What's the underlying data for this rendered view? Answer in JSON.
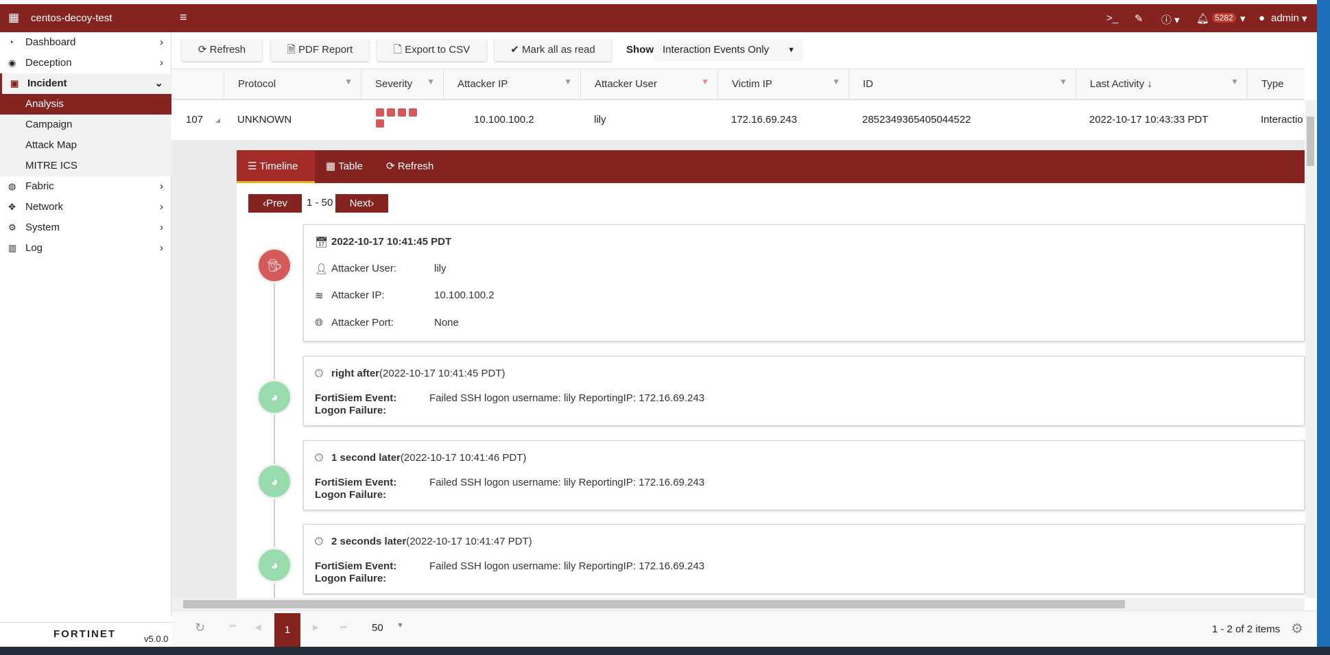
{
  "header": {
    "device_name": "centos-decoy-test",
    "alert_count": "5282",
    "user": "admin"
  },
  "sidebar": {
    "items": [
      {
        "label": "Dashboard",
        "icon": "dashboard-icon"
      },
      {
        "label": "Deception",
        "icon": "deception-icon"
      },
      {
        "label": "Incident",
        "icon": "incident-icon"
      },
      {
        "label": "Analysis"
      },
      {
        "label": "Campaign"
      },
      {
        "label": "Attack Map"
      },
      {
        "label": "MITRE ICS"
      },
      {
        "label": "Fabric",
        "icon": "fabric-icon"
      },
      {
        "label": "Network",
        "icon": "network-icon"
      },
      {
        "label": "System",
        "icon": "gear-icon"
      },
      {
        "label": "Log",
        "icon": "chart-icon"
      }
    ],
    "brand": "FORTINET",
    "version": "v5.0.0"
  },
  "toolbar": {
    "refresh": "Refresh",
    "pdf": "PDF Report",
    "export": "Export to CSV",
    "mark_read": "Mark all as read",
    "show_label": "Show",
    "show_value": "Interaction Events Only"
  },
  "table": {
    "columns": [
      "Protocol",
      "Severity",
      "Attacker IP",
      "Attacker User",
      "Victim IP",
      "ID",
      "Last Activity ↓",
      "Type"
    ],
    "row": {
      "num": "107",
      "protocol": "UNKNOWN",
      "severity": 5,
      "attacker_ip": "10.100.100.2",
      "attacker_user": "lily",
      "victim_ip": "172.16.69.243",
      "id": "2852349365405044522",
      "last_activity": "2022-10-17 10:43:33 PDT",
      "type": "Interactio"
    }
  },
  "detail": {
    "tabs": [
      "Timeline",
      "Table",
      "Refresh"
    ],
    "prev": "‹Prev",
    "range": "1 - 50",
    "next": "Next›",
    "first": {
      "date": "2022-10-17 10:41:45 PDT",
      "rows": [
        {
          "label": "Attacker User:",
          "value": "lily"
        },
        {
          "label": "Attacker IP:",
          "value": "10.100.100.2"
        },
        {
          "label": "Attacker Port:",
          "value": "None"
        }
      ]
    },
    "events": [
      {
        "rel": "right after",
        "ts": "(2022-10-17 10:41:45 PDT)",
        "label1": "FortiSiem Event:",
        "label2": "Logon Failure:",
        "value": "Failed SSH logon username: lily ReportingIP: 172.16.69.243"
      },
      {
        "rel": "1 second later",
        "ts": "(2022-10-17 10:41:46 PDT)",
        "label1": "FortiSiem Event:",
        "label2": "Logon Failure:",
        "value": "Failed SSH logon username: lily ReportingIP: 172.16.69.243"
      },
      {
        "rel": "2 seconds later",
        "ts": "(2022-10-17 10:41:47 PDT)",
        "label1": "FortiSiem Event:",
        "label2": "Logon Failure:",
        "value": "Failed SSH logon username: lily ReportingIP: 172.16.69.243"
      }
    ]
  },
  "pager": {
    "page": "1",
    "page_size": "50",
    "summary": "1 - 2 of 2 items"
  },
  "colors": {
    "brand": "#842320",
    "severity": "#d65a5a",
    "event_circle": "#98dcae"
  }
}
